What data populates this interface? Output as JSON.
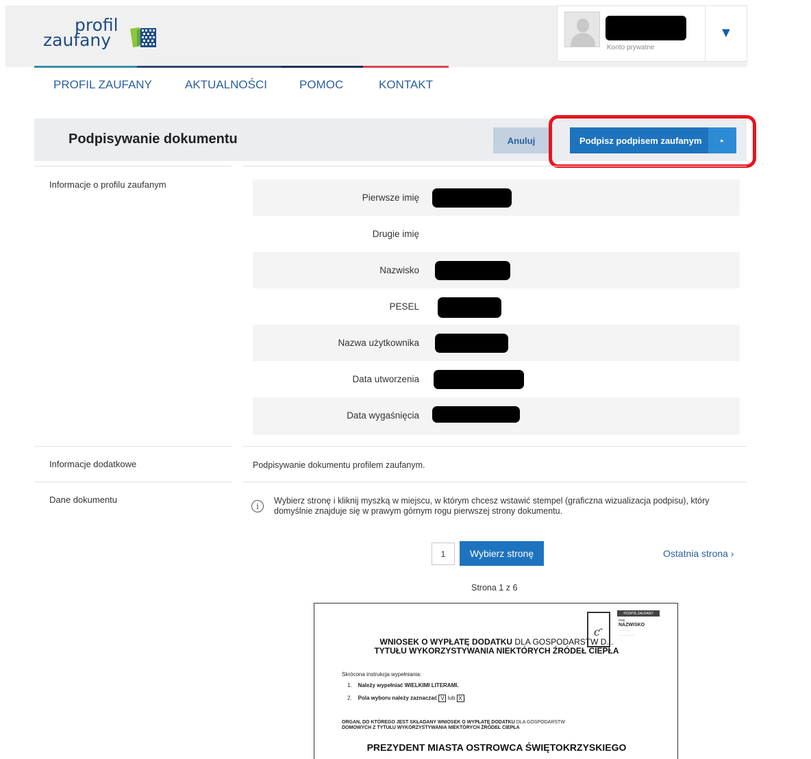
{
  "logo": {
    "line1": "profil",
    "line2": "zaufany"
  },
  "account": {
    "type": "Konto prywatne"
  },
  "nav": [
    {
      "label": "PROFIL ZAUFANY"
    },
    {
      "label": "AKTUALNOŚCI"
    },
    {
      "label": "POMOC"
    },
    {
      "label": "KONTAKT"
    }
  ],
  "header": {
    "title": "Podpisywanie dokumentu",
    "cancel_label": "Anuluj",
    "sign_label": "Podpisz podpisem zaufanym",
    "sign_arrow": "▸"
  },
  "profile_section": {
    "label": "Informacje o profilu zaufanym",
    "rows": [
      {
        "label": "Pierwsze imię"
      },
      {
        "label": "Drugie imię"
      },
      {
        "label": "Nazwisko"
      },
      {
        "label": "PESEL"
      },
      {
        "label": "Nazwa użytkownika"
      },
      {
        "label": "Data utworzenia"
      },
      {
        "label": "Data wygaśnięcia"
      }
    ]
  },
  "additional": {
    "label": "Informacje dodatkowe",
    "text": "Podpisywanie dokumentu profilem zaufanym."
  },
  "document": {
    "label": "Dane dokumentu",
    "instruction": "Wybierz stronę i kliknij myszką w miejscu, w którym chcesz wstawić stempel (graficzna wizualizacja podpisu), który domyślnie znajduje się w prawym górnym rogu pierwszej strony dokumentu.",
    "page_input_value": "1",
    "select_page_label": "Wybierz stronę",
    "last_page_label": "Ostatnia strona ›",
    "page_counter": "Strona 1 z 6"
  },
  "preview": {
    "stamp_header": "PODPIS ZAUFANY",
    "stamp_imie": "Imię",
    "stamp_name": "NAZWISKO",
    "title_bold": "WNIOSEK O WYPŁATĘ DODATKU",
    "title_thin": "DLA GOSPODARSTW D...",
    "title_line2": "TYTUŁU WYKORZYSTYWANIA NIEKTÓRYCH ŹRÓDEŁ CIEPŁA",
    "instr_heading": "Skrócona instrukcja wypełniania:",
    "instr_1_num": "1.",
    "instr_1": "Należy wypełniać WIELKIMI LITERAMI.",
    "instr_2_num": "2.",
    "instr_2": "Pola wyboru należy zaznaczać",
    "check_v": "V",
    "lub": "lub",
    "check_x": "X",
    "organ_bold": "ORGAN, DO KTÓREGO JEST SKŁADANY WNIOSEK O WYPŁATĘ DODATKU",
    "organ_thin": "DLA GOSPODARSTW",
    "organ_line2": "DOMOWYCH Z TYTUŁU WYKORZYSTYWANIA NIEKTÓRYCH ŹRÓDEŁ CIEPŁA",
    "city": "PREZYDENT MIASTA OSTROWCA ŚWIĘTOKRZYSKIEGO"
  }
}
